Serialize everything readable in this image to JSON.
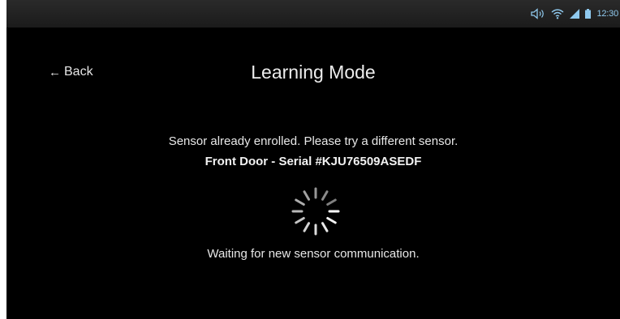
{
  "status_bar": {
    "time": "12:30",
    "icons": [
      "volume-icon",
      "wifi-icon",
      "signal-icon",
      "battery-icon"
    ],
    "accent": "#8fc9ee"
  },
  "header": {
    "back_label": "Back",
    "title": "Learning Mode"
  },
  "main": {
    "warning": "Sensor already enrolled. Please try a different sensor.",
    "sensor": "Front Door - Serial #KJU76509ASEDF",
    "waiting": "Waiting for new sensor communication."
  },
  "spinner": {
    "icon": "loading-spinner-icon"
  }
}
